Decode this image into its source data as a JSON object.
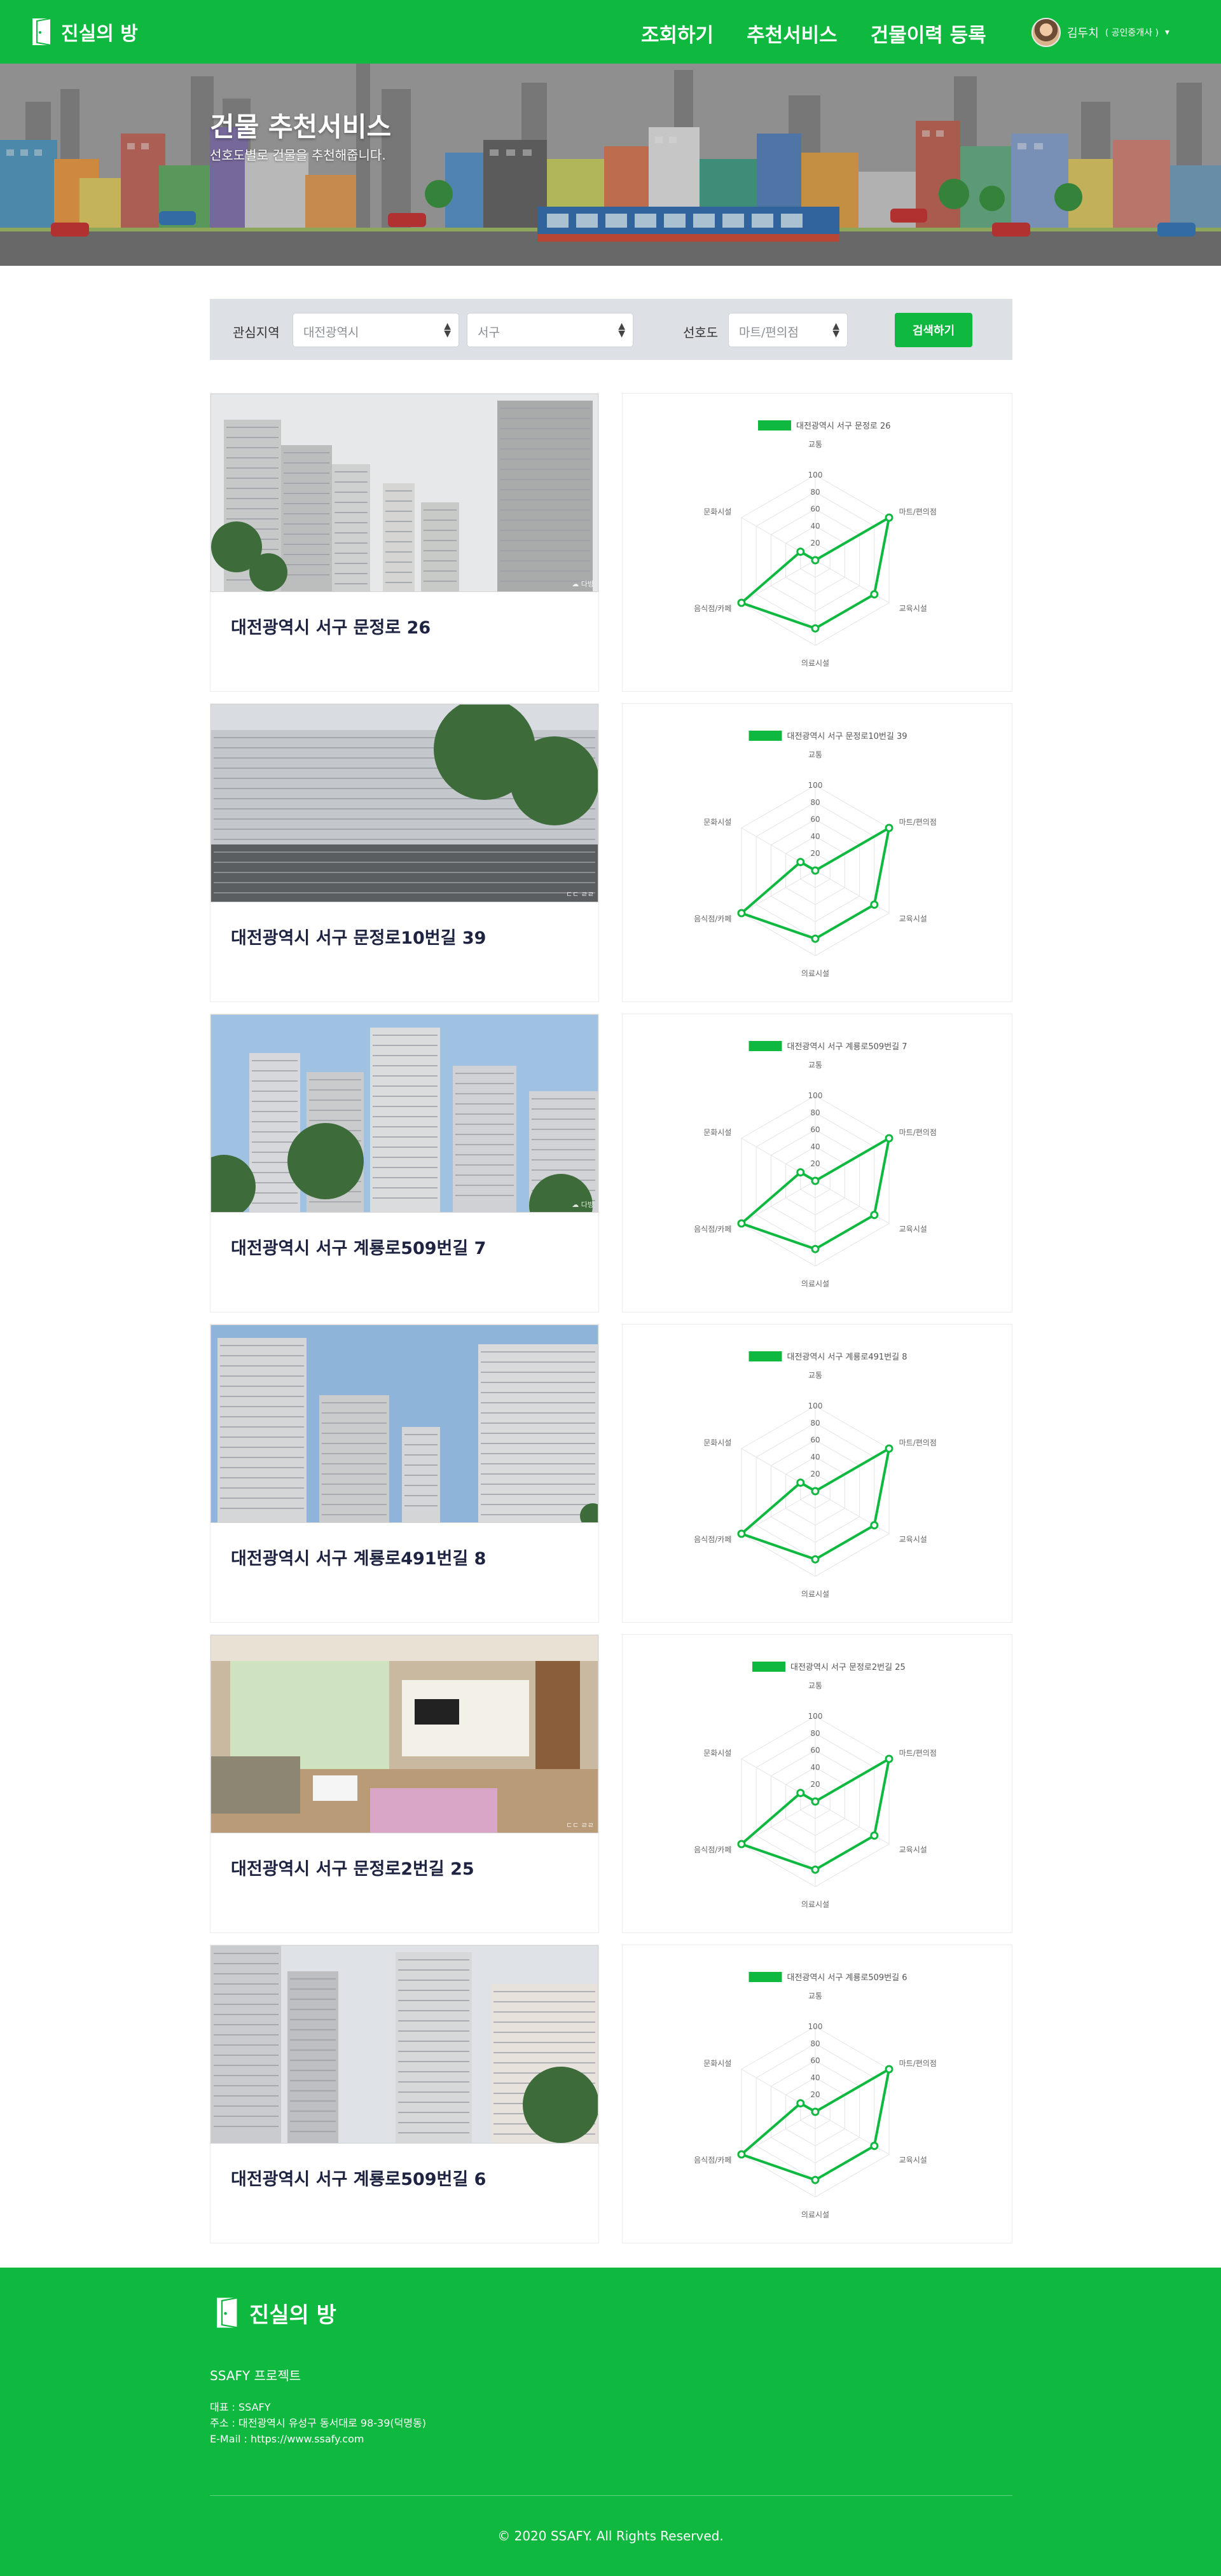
{
  "nav": {
    "logo_text": "진실의 방",
    "links": [
      "조회하기",
      "추천서비스",
      "건물이력 등록"
    ],
    "user_name": "김두치",
    "user_role": "( 공인중개사 )"
  },
  "hero": {
    "title": "건물 추천서비스",
    "subtitle": "선호도별로 건물을 추천해줍니다."
  },
  "filter": {
    "region_label": "관심지역",
    "city_value": "대전광역시",
    "district_value": "서구",
    "pref_label": "선호도",
    "pref_value": "마트/편의점",
    "search_label": "검색하기"
  },
  "radar_axes": [
    "교통",
    "마트/편의점",
    "교육시설",
    "의료시설",
    "음식점/카페",
    "문화시설"
  ],
  "radar_ticks": [
    "20",
    "40",
    "60",
    "80",
    "100"
  ],
  "radar_max": 100,
  "accent": "#0fb83e",
  "results": [
    {
      "address": "대전광역시 서구 문정로 26",
      "legend": "대전광역시 서구 문정로 26",
      "values": [
        0,
        100,
        80,
        80,
        100,
        20
      ],
      "photo": "apartment-towers-cloudy",
      "watermark": "☁ 다방"
    },
    {
      "address": "대전광역시 서구 문정로10번길 39",
      "legend": "대전광역시 서구 문정로10번길 39",
      "values": [
        0,
        100,
        80,
        80,
        100,
        20
      ],
      "photo": "apartment-front-wall",
      "watermark": "ㄷㄷ ㄹㄹ"
    },
    {
      "address": "대전광역시 서구 계룡로509번길 7",
      "legend": "대전광역시 서구 계룡로509번길 7",
      "values": [
        0,
        100,
        80,
        80,
        100,
        20
      ],
      "photo": "apartment-trees",
      "watermark": "☁ 다방"
    },
    {
      "address": "대전광역시 서구 계룡로491번길 8",
      "legend": "대전광역시 서구 계룡로491번길 8",
      "values": [
        0,
        100,
        80,
        80,
        100,
        20
      ],
      "photo": "apartment-blue-sky",
      "watermark": ""
    },
    {
      "address": "대전광역시 서구 문정로2번길 25",
      "legend": "대전광역시 서구 문정로2번길 25",
      "values": [
        0,
        100,
        80,
        80,
        100,
        20
      ],
      "photo": "living-room-interior",
      "watermark": "ㄷㄷ ㄹㄹ"
    },
    {
      "address": "대전광역시 서구 계룡로509번길 6",
      "legend": "대전광역시 서구 계룡로509번길 6",
      "values": [
        0,
        100,
        80,
        80,
        100,
        20
      ],
      "photo": "apartment-street-signs",
      "watermark": ""
    }
  ],
  "footer": {
    "logo_text": "진실의 방",
    "project": "SSAFY 프로젝트",
    "info_lines": [
      "대표 : SSAFY",
      "주소 : 대전광역시 유성구 동서대로 98-39(덕명동)",
      "E-Mail : https://www.ssafy.com"
    ],
    "copyright": "© 2020 SSAFY. All Rights Reserved."
  }
}
